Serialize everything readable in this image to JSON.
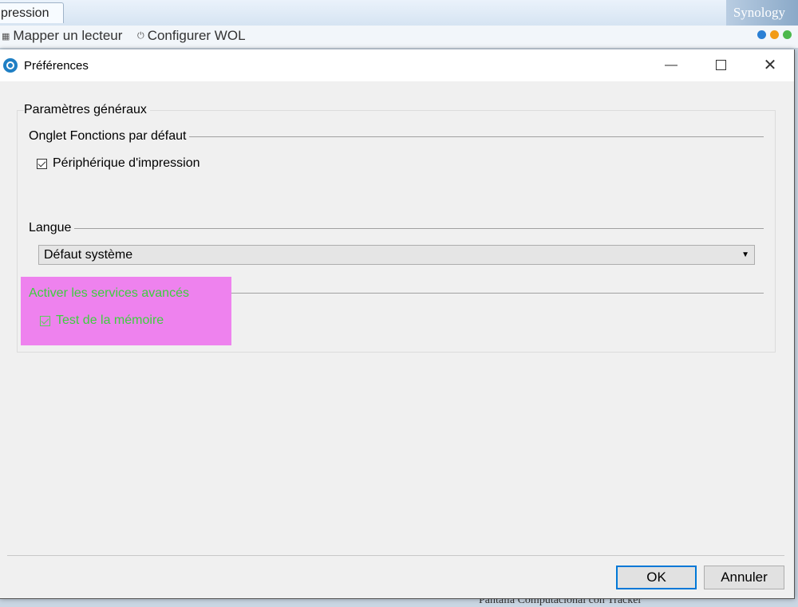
{
  "background": {
    "tab_label": "pression",
    "brand": "Synology",
    "toolbar": {
      "map_drive": "Mapper un lecteur",
      "configure_wol": "Configurer WOL"
    },
    "status_colors": [
      "#2a7fd4",
      "#f29b16",
      "#4cb84c"
    ],
    "footer_text": "Pantalla Computacional con Tracker"
  },
  "dialog": {
    "title": "Préférences",
    "window_controls": {
      "minimize": "—",
      "close": "✕"
    },
    "general_group_title": "Paramètres généraux",
    "default_tab_section": {
      "title": "Onglet Fonctions par défaut",
      "checkbox_label": "Périphérique d'impression",
      "checked": true
    },
    "language_section": {
      "title": "Langue",
      "selected": "Défaut système"
    },
    "advanced_section": {
      "title": "Activer les services avancés",
      "checkbox_label": "Test de la mémoire",
      "checked": true,
      "highlight_color": "#ee82ee",
      "text_color": "#3ecf3e"
    },
    "buttons": {
      "ok": "OK",
      "cancel": "Annuler"
    }
  }
}
